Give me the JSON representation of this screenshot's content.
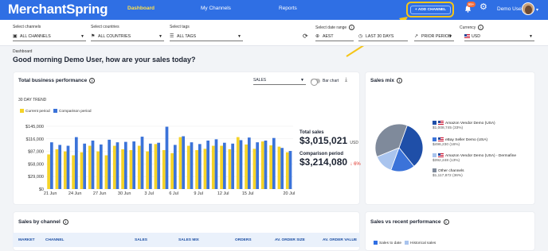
{
  "topbar": {
    "logo": "MerchantSpring",
    "nav": [
      "Dashboard",
      "My Channels",
      "Reports"
    ],
    "add_channels": "+ ADD CHANNEL",
    "notif_count": "99+",
    "user_name": "Demo User",
    "accent": "#2f6fe4",
    "highlight": "#f5c518"
  },
  "filters": {
    "channels_label": "Select channels",
    "channels_value": "ALL CHANNELS",
    "countries_label": "Select countries",
    "countries_value": "ALL COUNTRIES",
    "tags_label": "Select tags",
    "tags_value": "ALL TAGS",
    "date_label": "Select date range",
    "timezone": "AEST",
    "range_value": "LAST 30 DAYS",
    "compare_value": "PRIOR PERIOD",
    "currency_label": "Currency",
    "currency_value": "USD"
  },
  "breadcrumb": "Dashboard",
  "greeting": "Good morning Demo User, how are your sales today?",
  "performance": {
    "title": "Total business performance",
    "metric": "SALES",
    "toggle_label": "Bar chart",
    "trend_label": "30 DAY TREND",
    "legend_current": "Current period",
    "legend_comparison": "Comparison period",
    "total_sales_label": "Total sales",
    "total_sales_value": "$3,015,021",
    "total_sales_currency": "USD",
    "comparison_label": "Comparison period",
    "comparison_value": "$3,214,080",
    "comparison_change": "↓ 6%"
  },
  "chart_data": {
    "type": "bar",
    "title": "",
    "xlabel": "",
    "ylabel": "",
    "ylim": [
      0,
      145000
    ],
    "yticks": [
      "$145,000",
      "$116,000",
      "$87,000",
      "$58,000",
      "$29,000",
      "$0"
    ],
    "xticks": [
      "21 Jun",
      "24 Jun",
      "27 Jun",
      "30 Jun",
      "3 Jul",
      "6 Jul",
      "9 Jul",
      "12 Jul",
      "15 Jul",
      "20 Jul"
    ],
    "series": [
      {
        "name": "Current period",
        "color": "#f5d327",
        "values": [
          80000,
          92000,
          87000,
          78000,
          85000,
          100000,
          87000,
          78000,
          100000,
          92000,
          90000,
          100000,
          87000,
          104000,
          90000,
          83000,
          120000,
          100000,
          90000,
          93000,
          100000,
          100000,
          92000,
          120000,
          103000,
          93000,
          110000,
          101000,
          98000,
          85000
        ]
      },
      {
        "name": "Comparison period",
        "color": "#3b73d9",
        "values": [
          108000,
          102000,
          100000,
          120000,
          105000,
          112000,
          103000,
          114000,
          108000,
          109000,
          110000,
          121000,
          105000,
          107000,
          144000,
          102000,
          122000,
          108000,
          104000,
          112000,
          115000,
          107000,
          105000,
          113000,
          119000,
          108000,
          112000,
          118000,
          95000,
          88000
        ]
      }
    ]
  },
  "sales_mix": {
    "title": "Sales mix",
    "items": [
      {
        "name": "Amazon Vendor Demo (USA)",
        "value": "$1,008,745",
        "pct": "(33%)",
        "color": "#1f4fa8"
      },
      {
        "name": "eBay Seller Demo (USA)",
        "value": "$496,230",
        "pct": "(16%)",
        "color": "#3b73d9"
      },
      {
        "name": "Amazon Vendor Demo (USA) - Dermafine",
        "value": "$392,248",
        "pct": "(13%)",
        "color": "#a9c4ee"
      },
      {
        "name": "Other channels",
        "value": "$1,117,872",
        "pct": "(36%)",
        "color": "#7f8a9b"
      }
    ],
    "pie_values": [
      33,
      16,
      13,
      36
    ]
  },
  "sales_by_channel": {
    "title": "Sales by channel",
    "columns": [
      "MARKET",
      "CHANNEL",
      "SALES",
      "SALES MIX",
      "ORDERS",
      "AV. ORDER SIZE",
      "AV. ORDER VALUE"
    ]
  },
  "sales_vs_recent": {
    "title": "Sales vs recent performance",
    "legend": [
      "Sales to date",
      "Historical sales"
    ]
  }
}
